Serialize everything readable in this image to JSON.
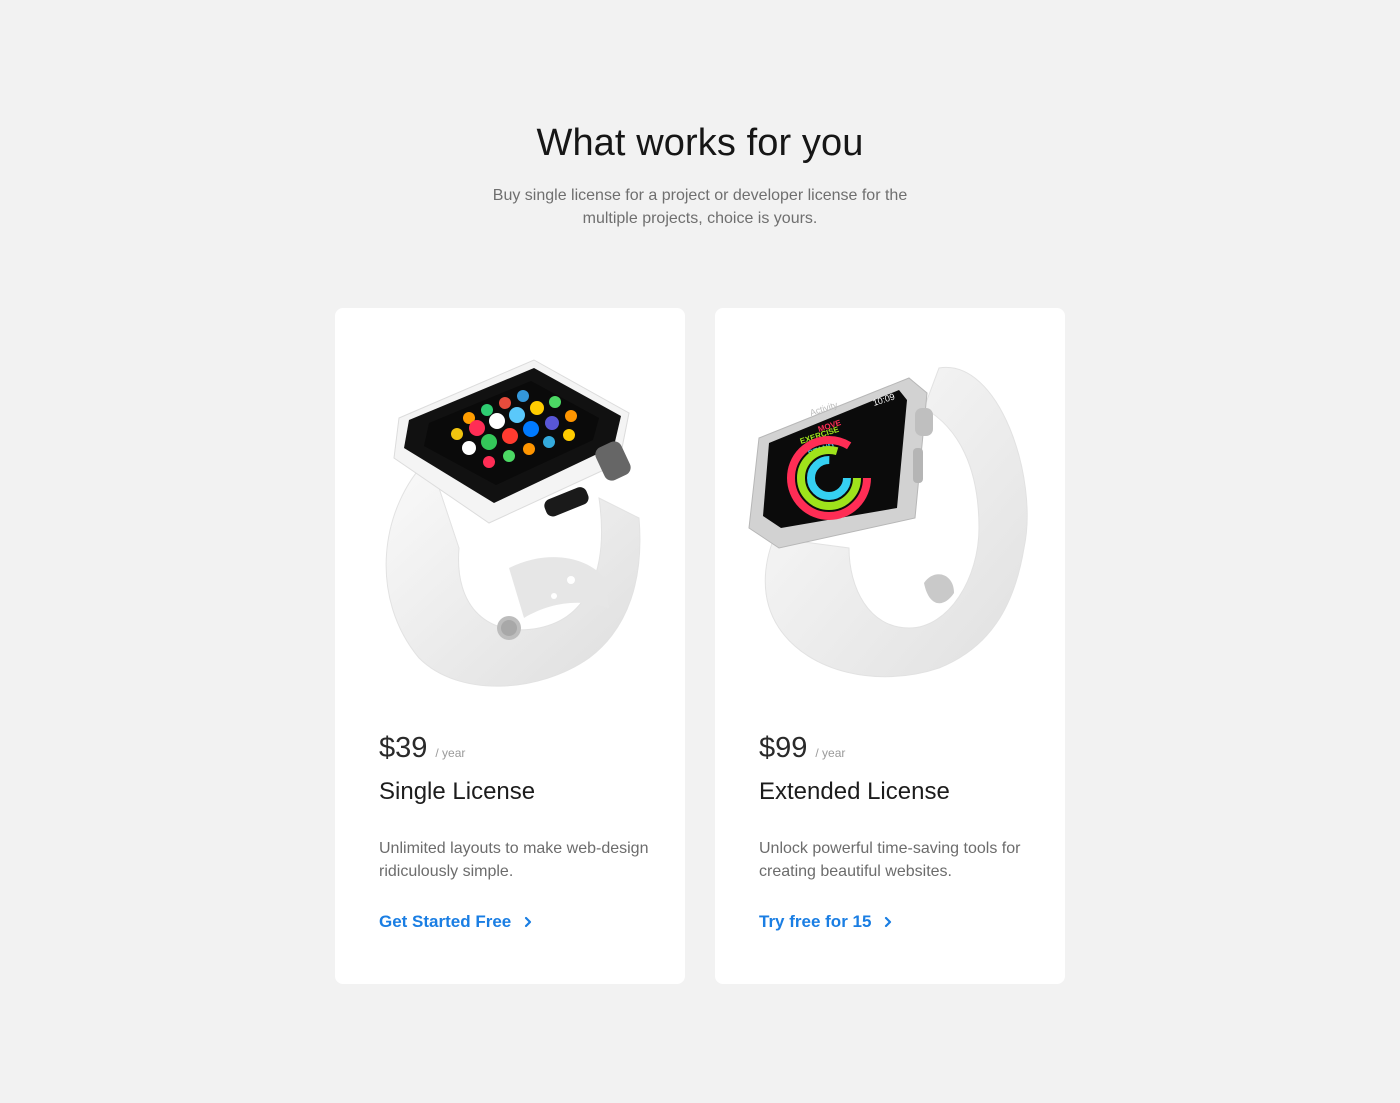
{
  "header": {
    "title": "What works for you",
    "subtitle": "Buy single license for a project or developer license for the multiple projects, choice is yours."
  },
  "plans": [
    {
      "price": "$39",
      "period": "/ year",
      "name": "Single License",
      "description": "Unlimited layouts to make web-design ridiculously simple.",
      "cta_label": "Get Started Free",
      "image": "white-smartwatch-black-bezel-image"
    },
    {
      "price": "$99",
      "period": "/ year",
      "name": "Extended License",
      "description": "Unlock powerful time-saving tools for creating beautiful websites.",
      "cta_label": "Try free for 15",
      "image": "white-smartwatch-activity-screen-image",
      "watch_screen": {
        "app": "Activity",
        "time": "10:09",
        "rings": [
          "MOVE",
          "EXERCISE",
          "STAND"
        ]
      }
    }
  ],
  "colors": {
    "background": "#f2f2f2",
    "card": "#ffffff",
    "link": "#1a7ee3",
    "text": "#1a1a1a",
    "muted": "#6f6f6f"
  }
}
